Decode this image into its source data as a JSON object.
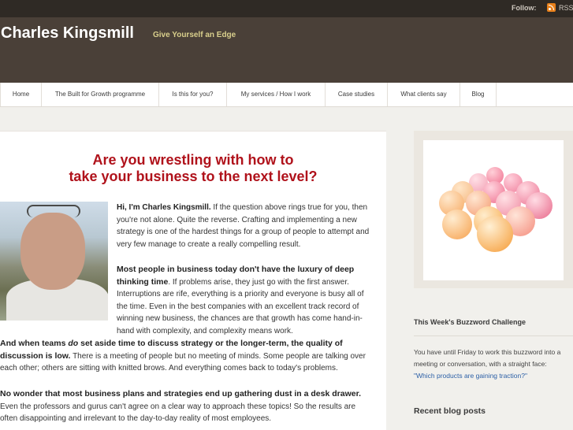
{
  "topbar": {
    "follow_label": "Follow:",
    "rss_label": "RSS"
  },
  "header": {
    "site_title": "Charles Kingsmill",
    "tagline": "Give Yourself an Edge"
  },
  "nav": {
    "items": [
      {
        "label": "Home"
      },
      {
        "label": "The Built for Growth programme"
      },
      {
        "label": "Is this for you?"
      },
      {
        "label": "My services / How I work"
      },
      {
        "label": "Case studies"
      },
      {
        "label": "What clients say"
      },
      {
        "label": "Blog"
      }
    ]
  },
  "main": {
    "headline_line1": "Are you wrestling with how to",
    "headline_line2": "take your business to the next level?",
    "p1_bold": "Hi, I'm Charles Kingsmill.",
    "p1_text": " If the question above rings true for you, then you're not alone.  Quite the reverse.  Crafting and implementing a new strategy is one of the hardest things for a group of people to attempt and very few manage to create a really compelling result.",
    "p2_bold": "Most people in business today don't have the luxury of deep thinking time",
    "p2_text": ". If problems arise, they just go with the first answer. Interruptions are rife, everything is a priority and everyone is busy all of the time. Even in the best companies with an excellent track record of winning new business, the chances are that growth has come hand-in-hand with complexity, and complexity means work.",
    "p3_bold_a": "And when teams ",
    "p3_bold_em": "do",
    "p3_bold_b": " set aside time to discuss strategy or the longer-term, the quality of discussion is low.",
    "p3_text": " There is a meeting of people but no meeting of minds. Some people are talking over each other; others are sitting with knitted brows. And everything comes back to today's problems.",
    "p4_bold": "No wonder that most business plans and strategies end up gathering dust in a desk drawer.",
    "p4_text": " Even the professors and gurus can't agree on a clear way to approach these topics! So the results are often disappointing and irrelevant to the day-to-day reality of most employees."
  },
  "sidebar": {
    "buzzword_title": "This Week's Buzzword Challenge",
    "buzzword_text": "You have until Friday to work this buzzword into a meeting or conversation, with a straight face:",
    "buzzword_link": "\"Which products are gaining traction?\"",
    "recent_title": "Recent blog posts"
  }
}
